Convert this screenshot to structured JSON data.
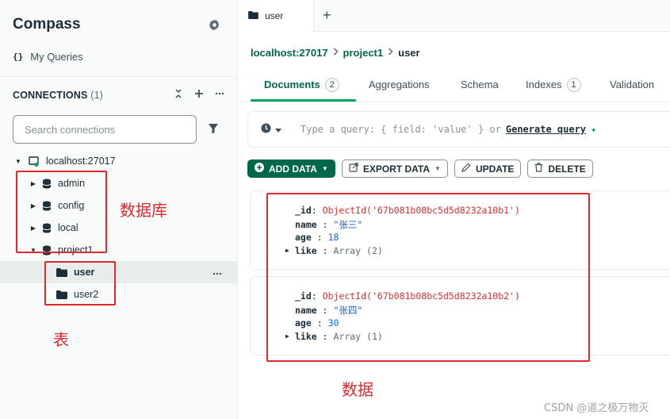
{
  "sidebar": {
    "app_title": "Compass",
    "settings_icon": "gear-icon",
    "my_queries_icon": "{}",
    "my_queries_label": "My Queries",
    "connections_label": "CONNECTIONS",
    "connections_count": "(1)",
    "search_placeholder": "Search connections",
    "tree": {
      "host": "localhost:27017",
      "databases": [
        {
          "name": "admin"
        },
        {
          "name": "config"
        },
        {
          "name": "local"
        },
        {
          "name": "project1"
        }
      ],
      "collections": [
        {
          "name": "user",
          "selected": true
        },
        {
          "name": "user2",
          "selected": false
        }
      ]
    }
  },
  "annotations": {
    "databases_label": "数据库",
    "tables_label": "表",
    "data_label": "数据"
  },
  "tabbar": {
    "active_tab": "user",
    "add_tab": "+"
  },
  "breadcrumb": {
    "host": "localhost:27017",
    "database": "project1",
    "collection": "user"
  },
  "subtabs": [
    {
      "label": "Documents",
      "badge": "2",
      "active": true
    },
    {
      "label": "Aggregations",
      "badge": "",
      "active": false
    },
    {
      "label": "Schema",
      "badge": "",
      "active": false
    },
    {
      "label": "Indexes",
      "badge": "1",
      "active": false
    },
    {
      "label": "Validation",
      "badge": "",
      "active": false
    }
  ],
  "querybar": {
    "placeholder_prefix": "Type a query: { field: 'value' } or",
    "generate_link": "Generate query",
    "sparkle": "✦"
  },
  "actions": {
    "add_data": "ADD DATA",
    "export_data": "EXPORT DATA",
    "update": "UPDATE",
    "delete": "DELETE"
  },
  "documents": [
    {
      "id_key": "_id",
      "id_value": "ObjectId('67b081b08bc5d5d8232a10b1')",
      "name_key": "name",
      "name_value": "\"张三\"",
      "age_key": "age",
      "age_value": "18",
      "like_key": "like",
      "like_value": "Array (2)"
    },
    {
      "id_key": "_id",
      "id_value": "ObjectId('67b081b08bc5d5d8232a10b2')",
      "name_key": "name",
      "name_value": "\"张四\"",
      "age_key": "age",
      "age_value": "30",
      "like_key": "like",
      "like_value": "Array (1)"
    }
  ],
  "watermark": "CSDN @道之极万物灭",
  "colors": {
    "brand_green": "#00684a",
    "accent_green": "#00a35c",
    "annotation_red": "#e0282e"
  }
}
